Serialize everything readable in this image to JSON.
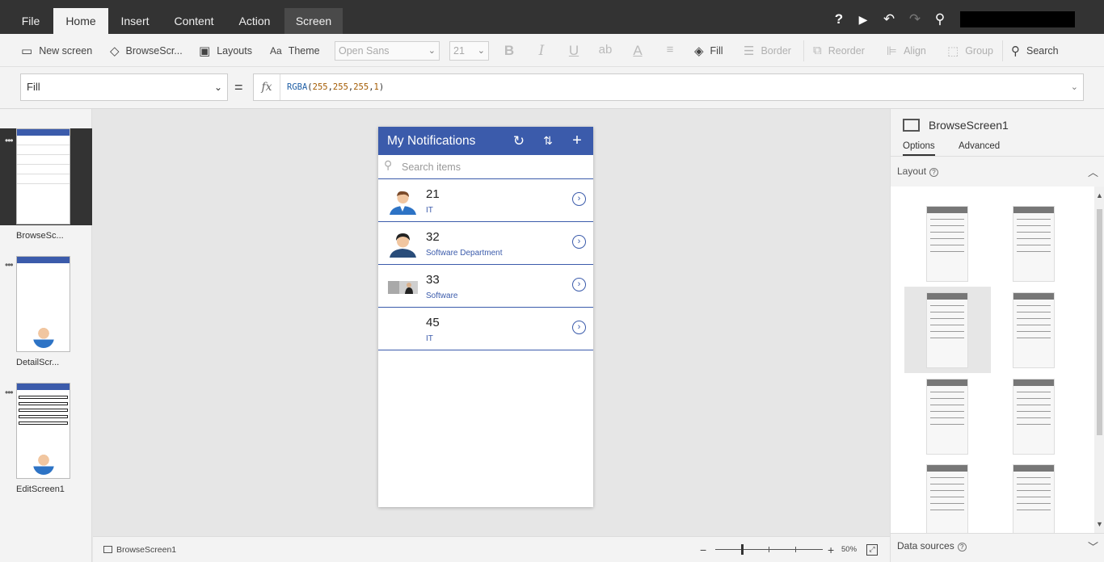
{
  "menu": {
    "tabs": [
      "File",
      "Home",
      "Insert",
      "Content",
      "Action",
      "Screen"
    ],
    "active": "Home"
  },
  "topbar": {
    "icons": [
      "help-icon",
      "play-icon",
      "undo-icon",
      "redo-icon",
      "user-icon"
    ]
  },
  "ribbon": {
    "new_screen": "New screen",
    "browse_screen": "BrowseScr...",
    "layouts": "Layouts",
    "theme": "Theme",
    "font": "Open Sans",
    "font_size": "21",
    "bold": "B",
    "italic": "I",
    "underline": "U",
    "strike": "ab",
    "font_color": "A",
    "fill": "Fill",
    "border": "Border",
    "reorder": "Reorder",
    "align": "Align",
    "group": "Group",
    "search": "Search"
  },
  "formula": {
    "property": "Fill",
    "eq": "=",
    "fx": "fx",
    "fn": "RGBA",
    "open": "(",
    "r": "255",
    "g": "255",
    "b": "255",
    "a": "1",
    "comma": ",",
    "close": ")"
  },
  "screens": [
    {
      "label": "BrowseSc..."
    },
    {
      "label": "DetailScr..."
    },
    {
      "label": "EditScreen1"
    }
  ],
  "app": {
    "title": "My Notifications",
    "search_placeholder": "Search items",
    "items": [
      {
        "title": "21",
        "subtitle": "IT"
      },
      {
        "title": "32",
        "subtitle": "Software Department"
      },
      {
        "title": "33",
        "subtitle": "Software"
      },
      {
        "title": "45",
        "subtitle": "IT"
      }
    ]
  },
  "right_panel": {
    "screen_name": "BrowseScreen1",
    "tabs": [
      "Options",
      "Advanced"
    ],
    "layout_label": "Layout",
    "data_sources_label": "Data sources"
  },
  "status": {
    "screen_name": "BrowseScreen1",
    "zoom": "50%"
  },
  "colors": {
    "accent": "#3b5bab",
    "menubar": "#333333"
  }
}
